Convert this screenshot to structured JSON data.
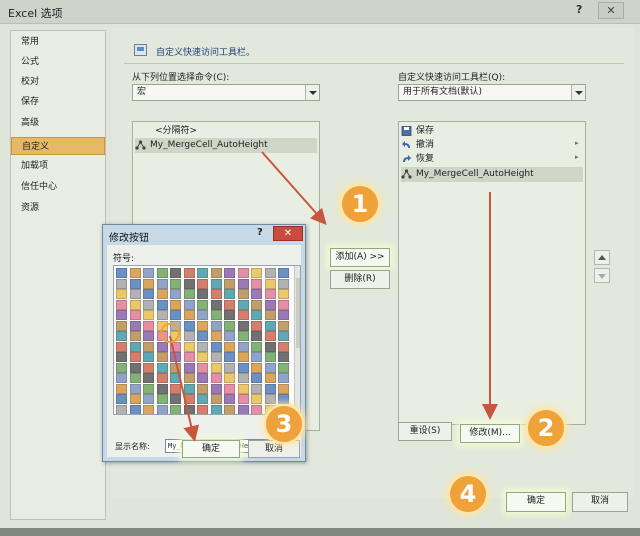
{
  "window": {
    "title": "Excel 选项",
    "help": "?",
    "close": "✕"
  },
  "nav": {
    "items": [
      {
        "label": "常用",
        "selected": false
      },
      {
        "label": "公式",
        "selected": false
      },
      {
        "label": "校对",
        "selected": false
      },
      {
        "label": "保存",
        "selected": false
      },
      {
        "label": "高级",
        "selected": false
      },
      {
        "label": "自定义",
        "selected": true
      },
      {
        "label": "加载项",
        "selected": false
      },
      {
        "label": "信任中心",
        "selected": false
      },
      {
        "label": "资源",
        "selected": false
      }
    ]
  },
  "header": {
    "title": "自定义快速访问工具栏。"
  },
  "left": {
    "choose_label": "从下列位置选择命令(C):",
    "choose_value": "宏",
    "items": [
      {
        "label": "<分隔符>",
        "selected": false
      },
      {
        "label": "My_MergeCell_AutoHeight",
        "selected": true
      }
    ]
  },
  "right": {
    "toolbar_label": "自定义快速访问工具栏(Q):",
    "toolbar_value": "用于所有文档(默认)",
    "items": [
      {
        "label": "保存",
        "icon": "save-icon"
      },
      {
        "label": "撤消",
        "icon": "undo-icon"
      },
      {
        "label": "恢复",
        "icon": "redo-icon"
      },
      {
        "label": "My_MergeCell_AutoHeight",
        "icon": "macro-icon"
      }
    ]
  },
  "buttons": {
    "add": "添加(A) >>",
    "remove": "删除(R)",
    "reset": "重设(S)",
    "modify": "修改(M)...",
    "ok": "确定",
    "cancel": "取消"
  },
  "dialog": {
    "title": "修改按钮",
    "help": "?",
    "close": "✕",
    "symbol_label": "符号:",
    "display_name_label": "显示名称:",
    "display_name_value": "My_MergeCell_AutoHeight",
    "ok": "确定",
    "cancel": "取消"
  },
  "steps": [
    "1",
    "2",
    "3",
    "4"
  ],
  "colors": {
    "highlight": "#e8b964",
    "badge": "#f0a23a",
    "arrow": "#c8553d",
    "dialog_close": "#cc4b3f"
  }
}
